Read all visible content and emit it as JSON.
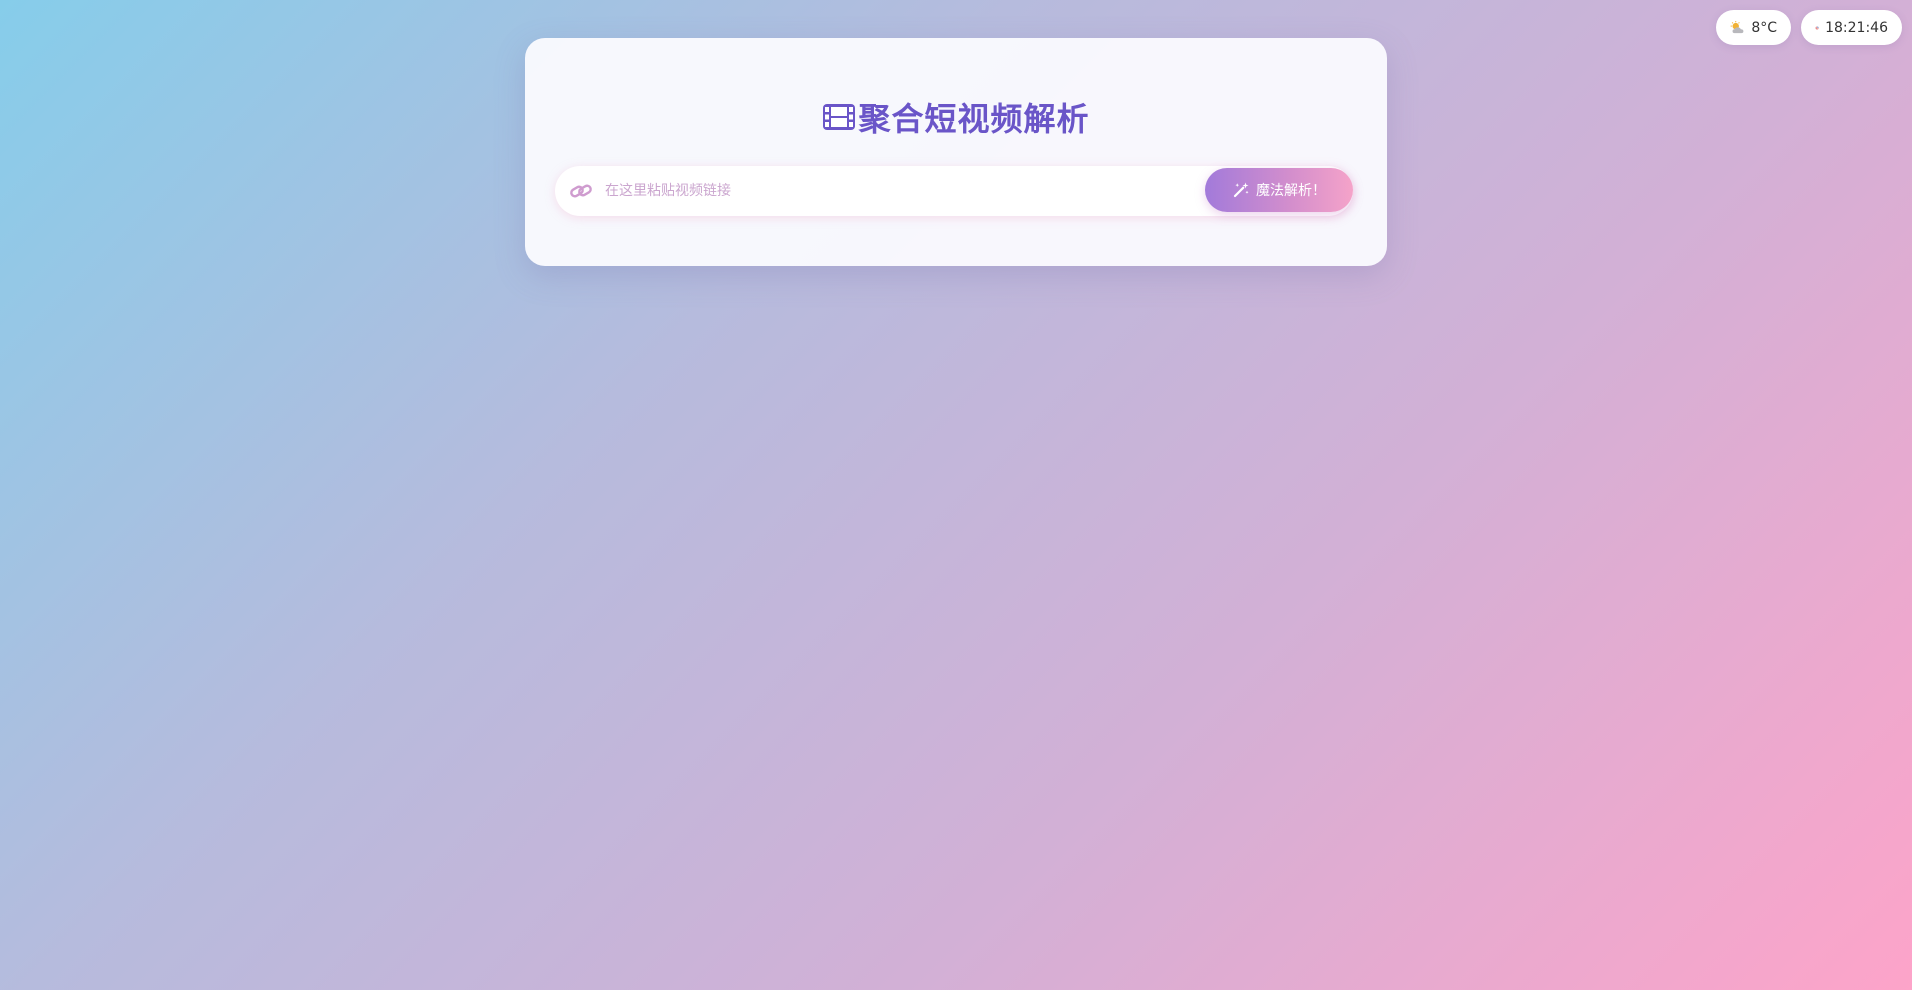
{
  "status": {
    "weather": {
      "icon": "partly-cloudy-icon",
      "temperature": "8°C"
    },
    "clock": {
      "icon": "clock-icon",
      "time": "18:21:46"
    }
  },
  "card": {
    "title_icon": "film-icon",
    "title": "聚合短视频解析",
    "search": {
      "icon": "link-icon",
      "placeholder": "在这里粘贴视频链接",
      "value": ""
    },
    "parse_button": {
      "icon": "magic-wand-icon",
      "label": "魔法解析！"
    }
  },
  "colors": {
    "title": "#6a55c8",
    "accent_start": "#a27ada",
    "accent_end": "#f5a3c9",
    "placeholder": "#cba6cf"
  }
}
